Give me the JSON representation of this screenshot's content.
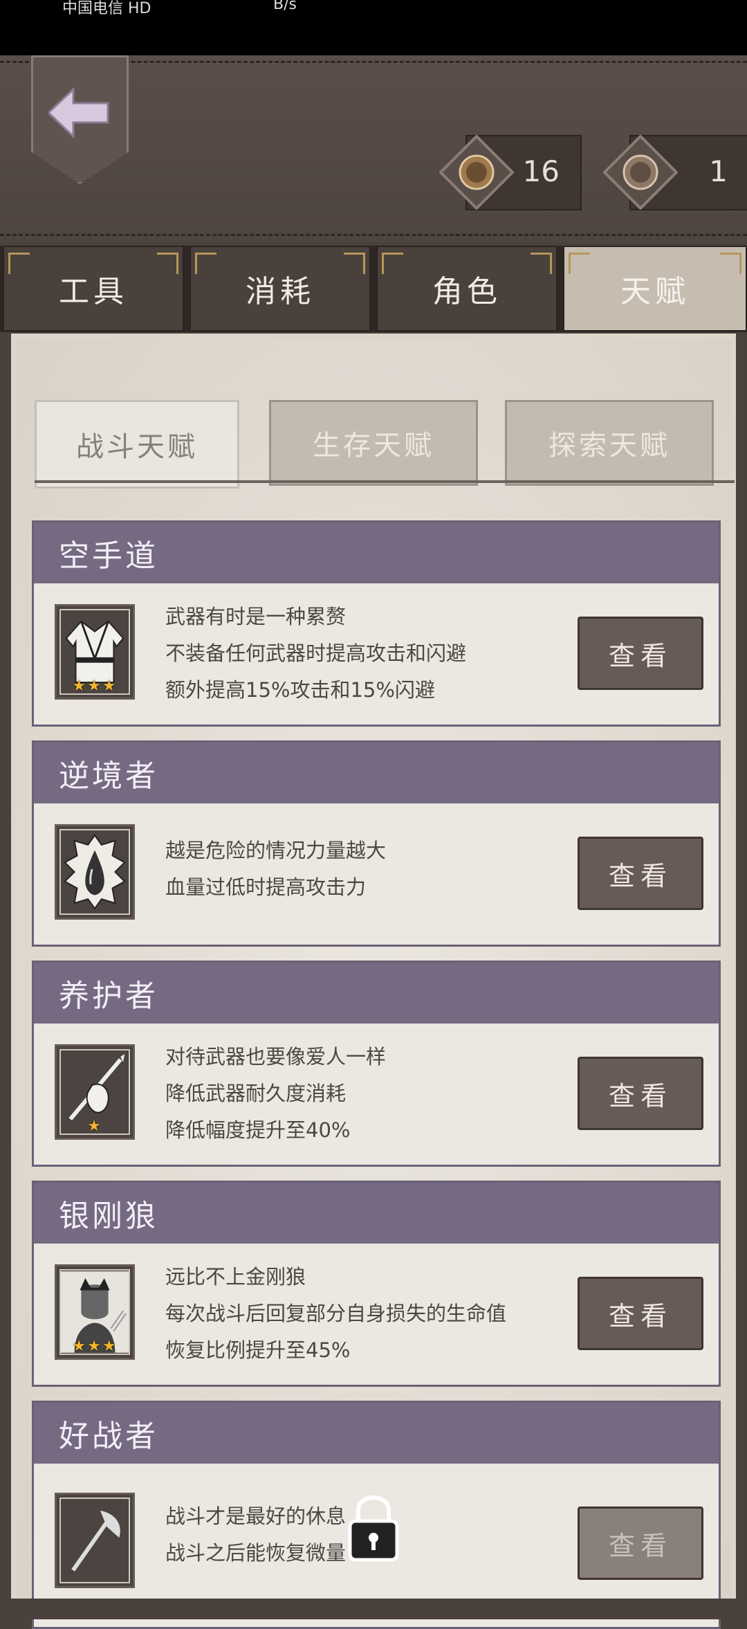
{
  "status_bar": {
    "carrier": "中国电信 HD",
    "speed": "B/s"
  },
  "header": {
    "back_button": "back-arrow-icon",
    "currencies": [
      {
        "icon": "coin-medal-icon",
        "count": "16"
      },
      {
        "icon": "coin-medal-silver-icon",
        "count": "1"
      }
    ]
  },
  "tabs": [
    {
      "label": "工具",
      "active": false
    },
    {
      "label": "消耗",
      "active": false
    },
    {
      "label": "角色",
      "active": false
    },
    {
      "label": "天赋",
      "active": true
    }
  ],
  "subtabs": [
    {
      "label": "战斗天赋",
      "active": true
    },
    {
      "label": "生存天赋",
      "active": false
    },
    {
      "label": "探索天赋",
      "active": false
    }
  ],
  "talents": [
    {
      "name": "空手道",
      "icon": "karate-gi-icon",
      "stars": "★★★",
      "lines": [
        "武器有时是一种累赘",
        "不装备任何武器时提高攻击和闪避",
        "额外提高15%攻击和15%闪避"
      ],
      "button": "查看",
      "locked": false
    },
    {
      "name": "逆境者",
      "icon": "blood-drop-icon",
      "stars": "",
      "lines": [
        "越是危险的情况力量越大",
        "血量过低时提高攻击力"
      ],
      "button": "查看",
      "locked": false
    },
    {
      "name": "养护者",
      "icon": "spear-hand-icon",
      "stars": "★",
      "lines": [
        "对待武器也要像爱人一样",
        "降低武器耐久度消耗",
        "降低幅度提升至40%"
      ],
      "button": "查看",
      "locked": false
    },
    {
      "name": "银刚狼",
      "icon": "wolverine-portrait-icon",
      "stars": "★★★",
      "lines": [
        "远比不上金刚狼",
        "每次战斗后回复部分自身损失的生命值",
        "恢复比例提升至45%"
      ],
      "button": "查看",
      "locked": false
    },
    {
      "name": "好战者",
      "icon": "axe-icon",
      "stars": "",
      "lines": [
        "战斗才是最好的休息",
        "战斗之后能恢复微量   神值"
      ],
      "button": "查看",
      "locked": true
    }
  ],
  "lock_icon": "padlock-icon"
}
